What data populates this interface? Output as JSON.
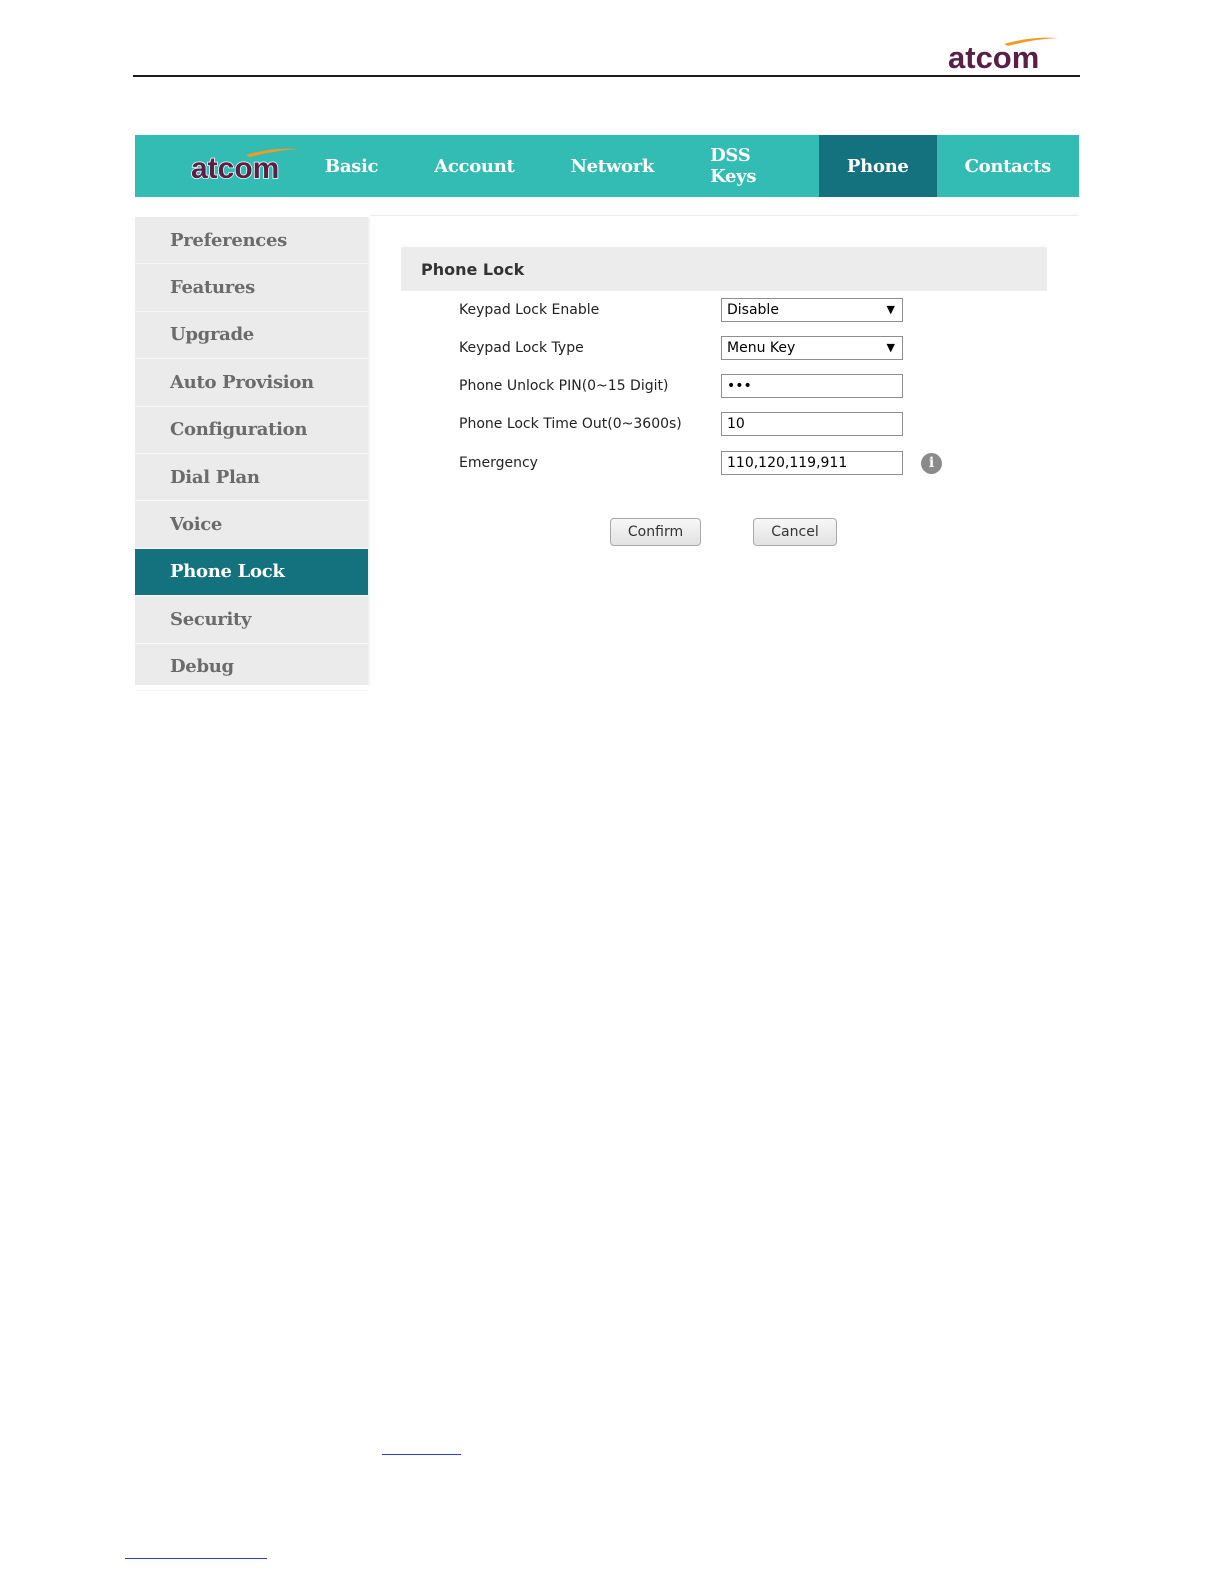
{
  "brand": {
    "logo_text": "atcom",
    "logo_color": "#5a1f45",
    "swoosh_color": "#f39a22"
  },
  "colors": {
    "nav_bg": "#33bcb3",
    "nav_active": "#13727d",
    "sidebar_bg": "#ebebeb"
  },
  "topnav": {
    "items": [
      "Basic",
      "Account",
      "Network",
      "DSS Keys",
      "Phone",
      "Contacts"
    ],
    "active": "Phone"
  },
  "sidebar": {
    "items": [
      "Preferences",
      "Features",
      "Upgrade",
      "Auto Provision",
      "Configuration",
      "Dial Plan",
      "Voice",
      "Phone Lock",
      "Security",
      "Debug"
    ],
    "active": "Phone Lock"
  },
  "panel": {
    "title": "Phone Lock"
  },
  "form": {
    "keypad_lock_enable": {
      "label": "Keypad Lock Enable",
      "value": "Disable"
    },
    "keypad_lock_type": {
      "label": "Keypad Lock Type",
      "value": "Menu Key"
    },
    "unlock_pin": {
      "label": "Phone Unlock PIN(0~15 Digit)",
      "value": "•••"
    },
    "lock_timeout": {
      "label": "Phone Lock Time Out(0~3600s)",
      "value": "10"
    },
    "emergency": {
      "label": "Emergency",
      "value": "110,120,119,911"
    }
  },
  "icons": {
    "dropdown": "▼",
    "info": "i"
  },
  "actions": {
    "confirm": "Confirm",
    "cancel": "Cancel"
  }
}
